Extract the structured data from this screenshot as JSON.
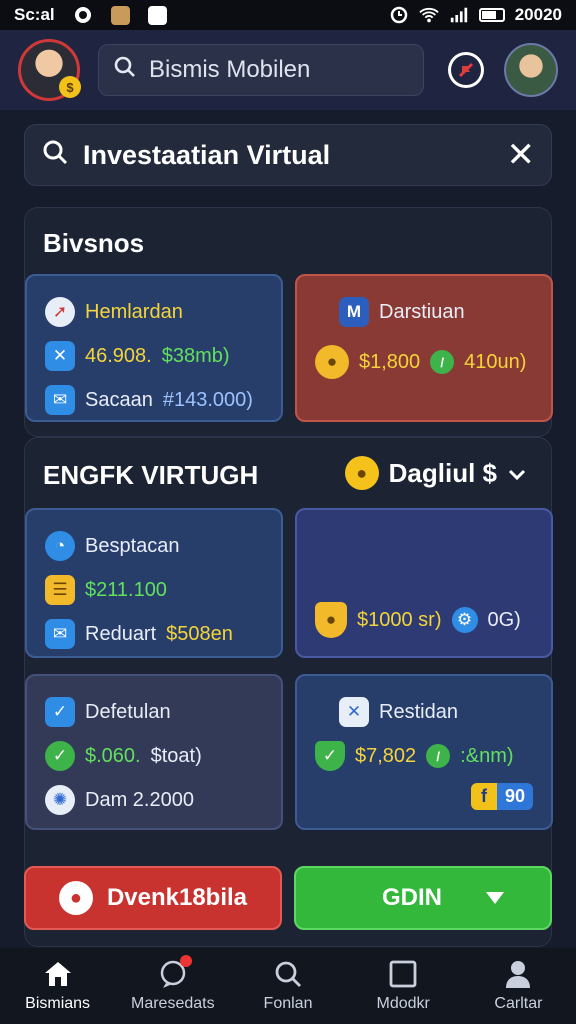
{
  "status_bar": {
    "left_text": "Sc:al",
    "time": "20020"
  },
  "header": {
    "search_text": "Bismis Mobilen",
    "avatar_badge": "$"
  },
  "search": {
    "value": "Investaatian Virtual"
  },
  "section1": {
    "title": "Bivsnos",
    "card_left": {
      "title": "Hemlardan",
      "row2_a": "46.908.",
      "row2_b": "$38mb)",
      "row3_a": "Sacaan",
      "row3_b": "#143.000)"
    },
    "card_right": {
      "title": "Darstiuan",
      "value_a": "$1,800",
      "value_b": "410un)"
    }
  },
  "section2": {
    "title": "ENGFK VIRTUGH",
    "dropdown_label": "Dagliul $",
    "card_a": {
      "title": "Besptacan",
      "value": "$211.100",
      "row3_a": "Reduart",
      "row3_b": "$508en"
    },
    "card_b": {
      "value_a": "$1000 sr)",
      "value_b": "0G)"
    },
    "card_c": {
      "title": "Defetulan",
      "row2_a": "$.060.",
      "row2_b": "$toat)",
      "row3": "Dam 2.2000"
    },
    "card_d": {
      "title": "Restidan",
      "value_a": "$7,802",
      "value_b": ":&nm)",
      "badge_f": "f",
      "badge_n": "90"
    }
  },
  "buttons": {
    "left": "Dvenk18bila",
    "right": "GDIN"
  },
  "bottom_nav": [
    {
      "label": "Bismians",
      "icon": "home-icon"
    },
    {
      "label": "Maresedats",
      "icon": "chat-icon"
    },
    {
      "label": "Fonlan",
      "icon": "search-icon"
    },
    {
      "label": "Mdodkr",
      "icon": "square-icon"
    },
    {
      "label": "Carltar",
      "icon": "person-icon"
    }
  ],
  "colors": {
    "accent_green": "#34b83b",
    "accent_red": "#c8322f",
    "gold": "#f4d43a"
  }
}
